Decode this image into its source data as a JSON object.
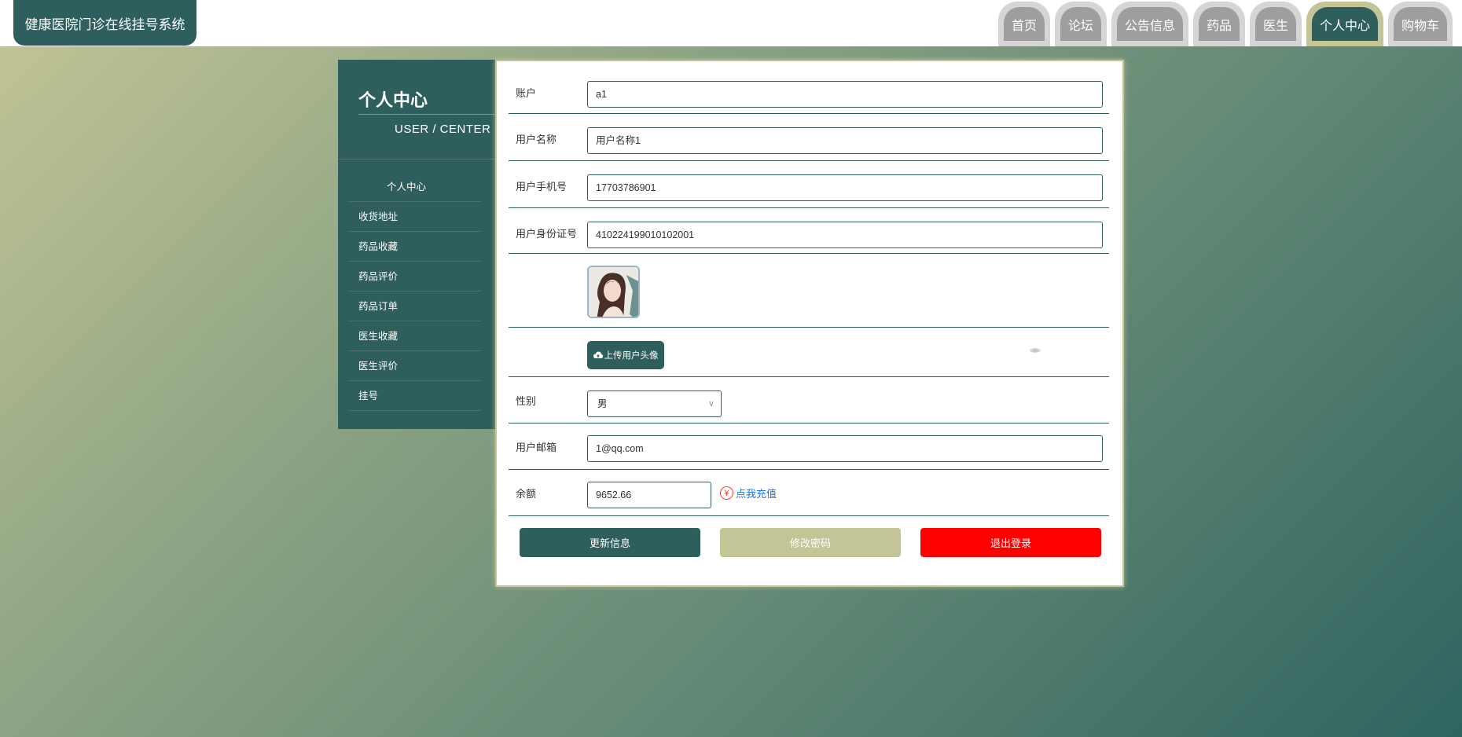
{
  "header": {
    "brand": "健康医院门诊在线挂号系统",
    "nav": [
      {
        "label": "首页"
      },
      {
        "label": "论坛"
      },
      {
        "label": "公告信息"
      },
      {
        "label": "药品"
      },
      {
        "label": "医生"
      },
      {
        "label": "个人中心",
        "active": true
      },
      {
        "label": "购物车"
      }
    ]
  },
  "sidebar": {
    "title": "个人中心",
    "subtitle": "USER / CENTER",
    "items": [
      {
        "label": "个人中心",
        "active": true
      },
      {
        "label": "收货地址"
      },
      {
        "label": "药品收藏"
      },
      {
        "label": "药品评价"
      },
      {
        "label": "药品订单"
      },
      {
        "label": "医生收藏"
      },
      {
        "label": "医生评价"
      },
      {
        "label": "挂号"
      }
    ]
  },
  "form": {
    "account": {
      "label": "账户",
      "value": "a1"
    },
    "username": {
      "label": "用户名称",
      "value": "用户名称1"
    },
    "phone": {
      "label": "用户手机号",
      "value": "17703786901"
    },
    "id_card": {
      "label": "用户身份证号",
      "value": "410224199010102001"
    },
    "upload_label": "上传用户头像",
    "gender": {
      "label": "性别",
      "value": "男"
    },
    "email": {
      "label": "用户邮箱",
      "value": "1@qq.com"
    },
    "balance": {
      "label": "余额",
      "value": "9652.66",
      "recharge_label": "点我充值"
    }
  },
  "actions": {
    "update": "更新信息",
    "change_password": "修改密码",
    "logout": "退出登录"
  },
  "colors": {
    "primary": "#2e5f5c",
    "accent": "#c4c596",
    "danger": "#ff0000",
    "link": "#1a73e8"
  }
}
